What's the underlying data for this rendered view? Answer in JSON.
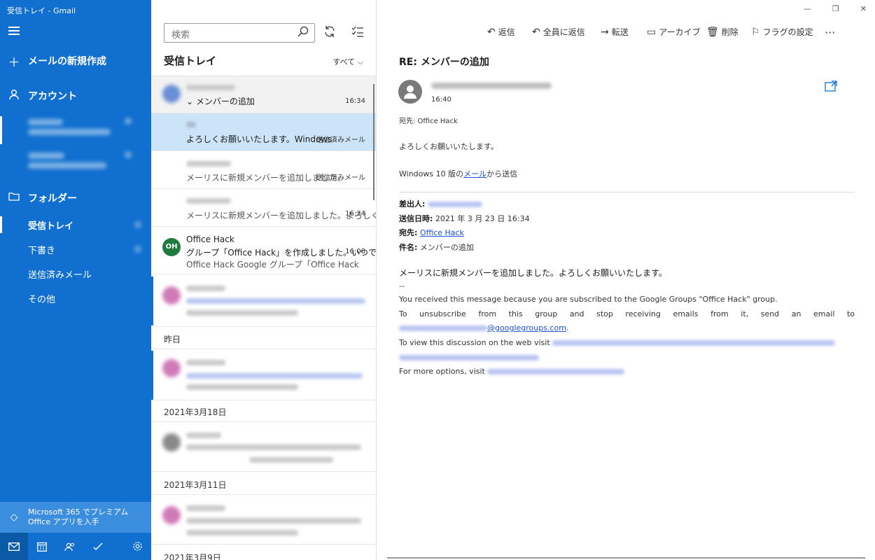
{
  "window": {
    "title": "受信トレイ - Gmail",
    "minimize": "—",
    "restore": "❐",
    "close": "✕"
  },
  "sidebar": {
    "new_mail": "メールの新規作成",
    "account": "アカウント",
    "folders_label": "フォルダー",
    "folders": [
      {
        "label": "受信トレイ"
      },
      {
        "label": "下書き"
      },
      {
        "label": "送信済みメール"
      },
      {
        "label": "その他"
      }
    ],
    "promo": "Microsoft 365 でプレミアム Office アプリを入手"
  },
  "list": {
    "search_placeholder": "検索",
    "title": "受信トレイ",
    "filter": "すべて",
    "conversations": [
      {
        "subject": "メンバーの追加",
        "time": "16:34"
      },
      {
        "preview": "よろしくお願いいたします。Windows",
        "tag": "送信済みメール"
      },
      {
        "preview": "メーリスに新規メンバーを追加しました。",
        "tag": "送信済みメール"
      },
      {
        "preview": "メーリスに新規メンバーを追加しました。よろしく",
        "time": "16:34"
      },
      {
        "initials": "OH",
        "sender": "Office Hack",
        "subject": "グループ「Office Hack」を作成しました。いつで",
        "time": "16:08",
        "preview": "Office Hack Google グループ「Office Hack"
      }
    ],
    "date_yesterday": "昨日",
    "date_1": "2021年3月18日",
    "date_2": "2021年3月11日",
    "date_3": "2021年3月9日"
  },
  "reading": {
    "toolbar": {
      "reply": "返信",
      "reply_all": "全員に返信",
      "forward": "転送",
      "archive": "アーカイブ",
      "delete": "削除",
      "flag": "フラグの設定",
      "more": "···"
    },
    "subject": "RE: メンバーの追加",
    "time": "16:40",
    "to": "宛先: Office Hack",
    "greeting": "よろしくお願いいたします。",
    "sent_from_prefix": "Windows 10 版の",
    "sent_from_link": "メール",
    "sent_from_suffix": "から送信",
    "meta": {
      "from_label": "差出人:",
      "date_label": "送信日時:",
      "date_value": "2021 年 3 月 23 日 16:34",
      "to_label": "宛先:",
      "to_value": "Office Hack",
      "subject_label": "件名:",
      "subject_value": "メンバーの追加"
    },
    "bold_line": "メーリスに新規メンバーを追加しました。よろしくお願いいたします。",
    "sig": "--",
    "en1": "You received this message because you are subscribed to the Google Groups \"Office Hack\" group.",
    "en2": "To unsubscribe from this group and stop receiving emails from it, send an email to",
    "en2_domain": "@googlegroups.com",
    "en3": "To view this discussion on the web visit",
    "en4": "For more options, visit"
  }
}
